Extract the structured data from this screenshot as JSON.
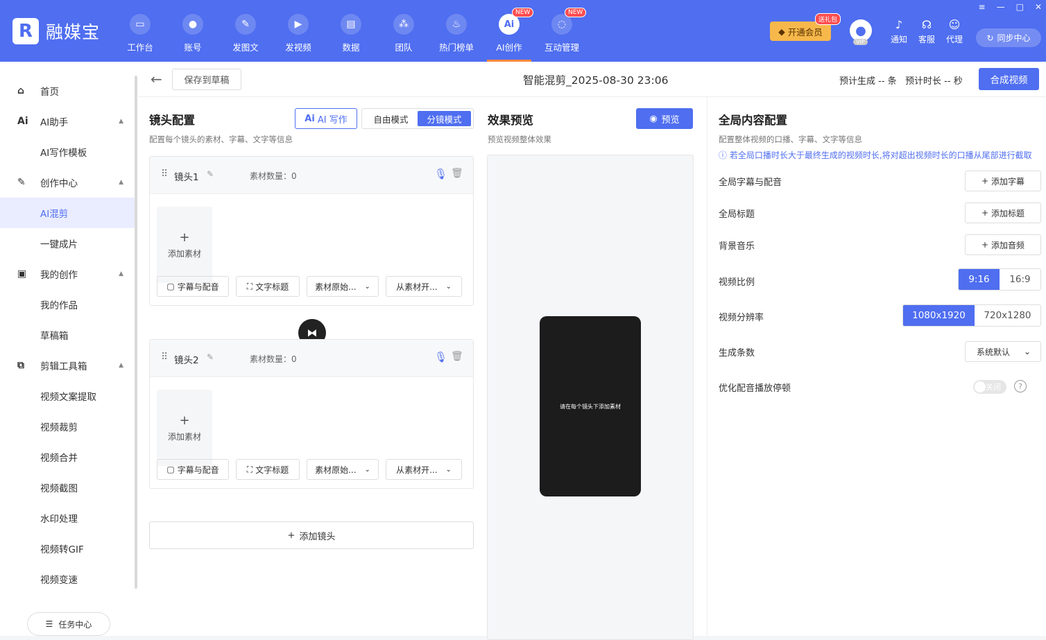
{
  "app": {
    "name": "融媒宝"
  },
  "nav": {
    "items": [
      {
        "label": "工作台",
        "icon": "monitor-icon"
      },
      {
        "label": "账号",
        "icon": "user-icon"
      },
      {
        "label": "发图文",
        "icon": "feather-icon"
      },
      {
        "label": "发视频",
        "icon": "play-icon"
      },
      {
        "label": "数据",
        "icon": "chart-icon"
      },
      {
        "label": "团队",
        "icon": "team-icon"
      },
      {
        "label": "热门榜单",
        "icon": "fire-icon"
      },
      {
        "label": "AI创作",
        "icon": "ai-icon",
        "badge": "NEW",
        "glyph": "Ai"
      },
      {
        "label": "互动管理",
        "icon": "chat-icon",
        "badge": "NEW"
      }
    ]
  },
  "header": {
    "vip_button": "开通会员",
    "gift_badge": "送礼包",
    "vip_tag": "VIP",
    "tools": [
      {
        "label": "通知",
        "icon": "bell-icon"
      },
      {
        "label": "客服",
        "icon": "headset-icon"
      },
      {
        "label": "代理",
        "icon": "agent-icon"
      }
    ],
    "sync_button": "同步中心"
  },
  "sidebar": {
    "items": [
      {
        "label": "首页",
        "icon": "home-icon",
        "top": 0
      },
      {
        "label": "AI助手",
        "icon": "ai-assistant-icon",
        "expandable": true
      },
      {
        "label": "AI写作模板",
        "sub": true
      },
      {
        "label": "创作中心",
        "icon": "pen-icon",
        "expandable": true
      },
      {
        "label": "AI混剪",
        "sub": true,
        "active": true
      },
      {
        "label": "一键成片",
        "sub": true
      },
      {
        "label": "我的创作",
        "icon": "document-icon",
        "expandable": true
      },
      {
        "label": "我的作品",
        "sub": true
      },
      {
        "label": "草稿箱",
        "sub": true
      },
      {
        "label": "剪辑工具箱",
        "icon": "crop-icon",
        "expandable": true
      },
      {
        "label": "视频文案提取",
        "sub": true
      },
      {
        "label": "视频裁剪",
        "sub": true
      },
      {
        "label": "视频合并",
        "sub": true
      },
      {
        "label": "视频截图",
        "sub": true
      },
      {
        "label": "水印处理",
        "sub": true
      },
      {
        "label": "视频转GIF",
        "sub": true
      },
      {
        "label": "视频变速",
        "sub": true
      }
    ],
    "task_center": "任务中心"
  },
  "subheader": {
    "save_draft": "保存到草稿",
    "title": "智能混剪_2025-08-30 23:06",
    "estimate": "预计生成 -- 条   预计时长 -- 秒",
    "compose": "合成视频"
  },
  "shots": {
    "title": "镜头配置",
    "desc": "配置每个镜头的素材、字幕、文字等信息",
    "ai_write": "AI 写作",
    "modes": [
      "自由模式",
      "分镜模式"
    ],
    "active_mode": 1,
    "cards": [
      {
        "name": "镜头1",
        "count": "素材数量：0"
      },
      {
        "name": "镜头2",
        "count": "素材数量：0"
      }
    ],
    "add_material": "添加素材",
    "subtitle_btn": "字幕与配音",
    "text_title_btn": "文字标题",
    "material_orig": "素材原始...",
    "from_start": "从素材开...",
    "add_shot": "添加镜头"
  },
  "preview": {
    "title": "效果预览",
    "desc": "预览视频整体效果",
    "button": "预览",
    "hint": "请在每个镜头下添加素材"
  },
  "global": {
    "title": "全局内容配置",
    "desc": "配置整体视频的口播、字幕、文字等信息",
    "warning": "若全局口播时长大于最终生成的视频时长,将对超出视频时长的口播从尾部进行截取",
    "subtitle_label": "全局字幕与配音",
    "subtitle_btn": "添加字幕",
    "title_label": "全局标题",
    "title_btn": "添加标题",
    "music_label": "背景音乐",
    "music_btn": "添加音频",
    "ratio_label": "视频比例",
    "ratios": [
      "9:16",
      "16:9"
    ],
    "resolution_label": "视频分辨率",
    "resolutions": [
      "1080x1920",
      "720x1280"
    ],
    "count_label": "生成条数",
    "count_value": "系统默认",
    "optimize_label": "优化配音播放停顿",
    "switch_label": "关闭"
  },
  "colors": {
    "accent": "#4f6ef0",
    "vip": "#f7b84b",
    "badge": "#ff4d4f"
  }
}
